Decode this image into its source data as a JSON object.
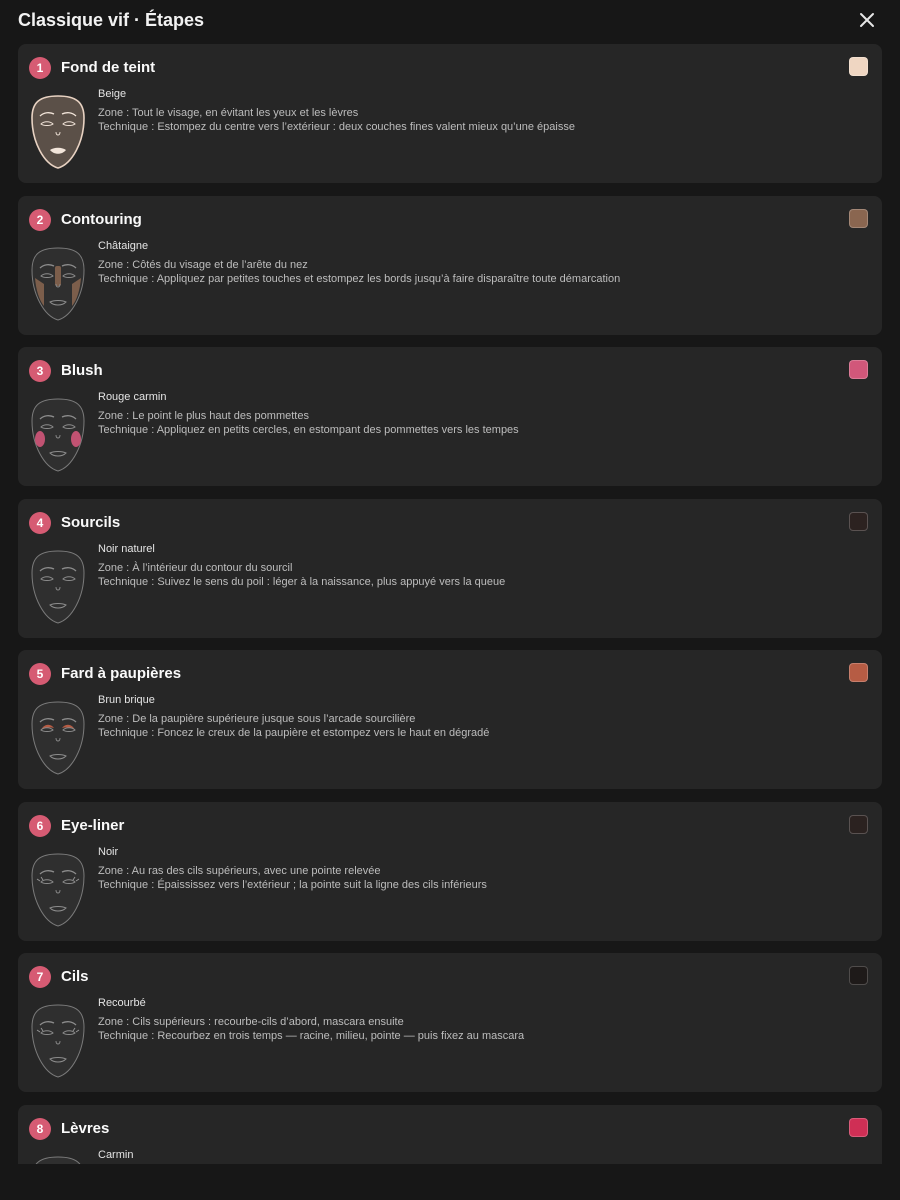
{
  "header": {
    "title": "Classique vif · Étapes",
    "close_icon": "close-icon"
  },
  "labels": {
    "zone_prefix": "Zone : ",
    "technique_prefix": "Technique : "
  },
  "steps": [
    {
      "num": "1",
      "title": "Fond de teint",
      "product": "Beige",
      "swatch": "#efd6c2",
      "zone": "Tout le visage, en évitant les yeux et les lèvres",
      "technique": "Estompez du centre vers l’extérieur : deux couches fines valent mieux qu’une épaisse",
      "face": "foundation"
    },
    {
      "num": "2",
      "title": "Contouring",
      "product": "Châtaigne",
      "swatch": "#8a6650",
      "zone": "Côtés du visage et de l’arête du nez",
      "technique": "Appliquez par petites touches et estompez les bords jusqu’à faire disparaître toute démarcation",
      "face": "contour"
    },
    {
      "num": "3",
      "title": "Blush",
      "product": "Rouge carmin",
      "swatch": "#d1577a",
      "zone": "Le point le plus haut des pommettes",
      "technique": "Appliquez en petits cercles, en estompant des pommettes vers les tempes",
      "face": "blush"
    },
    {
      "num": "4",
      "title": "Sourcils",
      "product": "Noir naturel",
      "swatch": "#2c2220",
      "zone": "À l’intérieur du contour du sourcil",
      "technique": "Suivez le sens du poil : léger à la naissance, plus appuyé vers la queue",
      "face": "brows"
    },
    {
      "num": "5",
      "title": "Fard à paupières",
      "product": "Brun brique",
      "swatch": "#b65c44",
      "zone": "De la paupière supérieure jusque sous l’arcade sourcilière",
      "technique": "Foncez le creux de la paupière et estompez vers le haut en dégradé",
      "face": "eyeshadow"
    },
    {
      "num": "6",
      "title": "Eye-liner",
      "product": "Noir",
      "swatch": "#2b2220",
      "zone": "Au ras des cils supérieurs, avec une pointe relevée",
      "technique": "Épaississez vers l’extérieur ; la pointe suit la ligne des cils inférieurs",
      "face": "eyeliner"
    },
    {
      "num": "7",
      "title": "Cils",
      "product": "Recourbé",
      "swatch": "#1e1a19",
      "zone": "Cils supérieurs : recourbe-cils d’abord, mascara ensuite",
      "technique": "Recourbez en trois temps — racine, milieu, pointe — puis fixez au mascara",
      "face": "lashes"
    },
    {
      "num": "8",
      "title": "Lèvres",
      "product": "Carmin",
      "swatch": "#cf2f55",
      "zone": "",
      "technique": "",
      "face": "lips"
    }
  ]
}
